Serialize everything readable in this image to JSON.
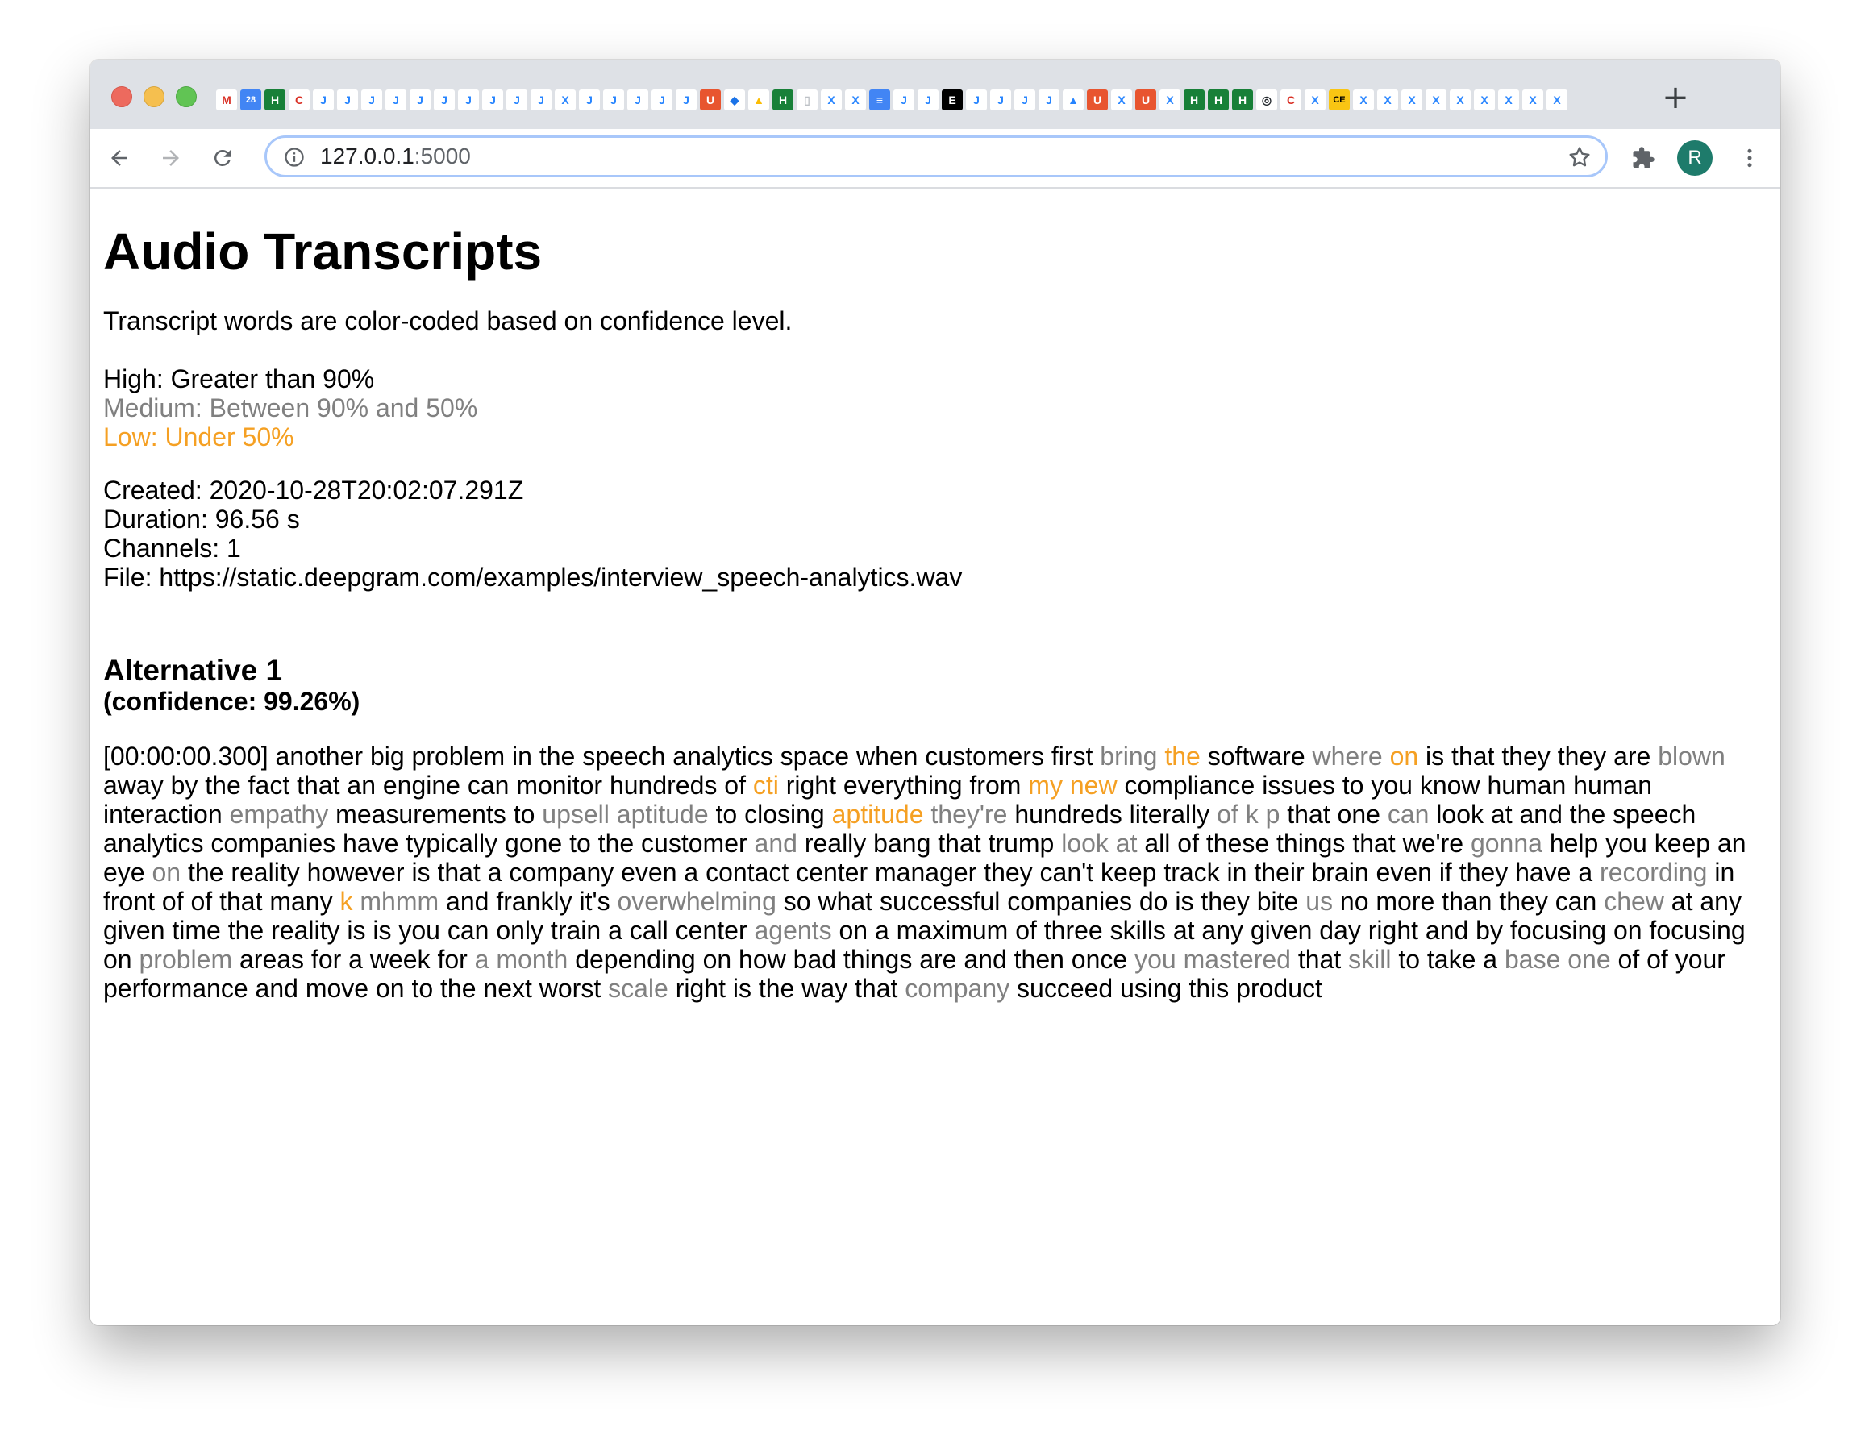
{
  "browser": {
    "url_host": "127.0.0.1",
    "url_port": ":5000",
    "avatar_letter": "R",
    "new_tab_symbol": "+",
    "tab_icons": [
      {
        "icon": "gmail-icon",
        "glyph": "M",
        "bg": "#ffffff",
        "fg": "#d93025"
      },
      {
        "icon": "calendar-icon",
        "glyph": "28",
        "bg": "#4285f4",
        "fg": "#ffffff"
      },
      {
        "icon": "sheets-icon",
        "glyph": "H",
        "bg": "#188038",
        "fg": "#ffffff"
      },
      {
        "icon": "refresh-red-icon",
        "glyph": "C",
        "bg": "#ffffff",
        "fg": "#d93025"
      },
      {
        "icon": "jira-icon",
        "glyph": "J",
        "bg": "#ffffff",
        "fg": "#2684ff"
      },
      {
        "icon": "jira-icon",
        "glyph": "J",
        "bg": "#ffffff",
        "fg": "#2684ff"
      },
      {
        "icon": "jira-icon",
        "glyph": "J",
        "bg": "#ffffff",
        "fg": "#2684ff"
      },
      {
        "icon": "jira-icon",
        "glyph": "J",
        "bg": "#ffffff",
        "fg": "#2684ff"
      },
      {
        "icon": "jira-icon",
        "glyph": "J",
        "bg": "#ffffff",
        "fg": "#2684ff"
      },
      {
        "icon": "jira-icon",
        "glyph": "J",
        "bg": "#ffffff",
        "fg": "#2684ff"
      },
      {
        "icon": "jira-icon",
        "glyph": "J",
        "bg": "#ffffff",
        "fg": "#2684ff"
      },
      {
        "icon": "jira-icon",
        "glyph": "J",
        "bg": "#ffffff",
        "fg": "#2684ff"
      },
      {
        "icon": "jira-icon",
        "glyph": "J",
        "bg": "#ffffff",
        "fg": "#2684ff"
      },
      {
        "icon": "jira-icon",
        "glyph": "J",
        "bg": "#ffffff",
        "fg": "#2684ff"
      },
      {
        "icon": "confluence-icon",
        "glyph": "X",
        "bg": "#ffffff",
        "fg": "#2684ff"
      },
      {
        "icon": "jira-icon",
        "glyph": "J",
        "bg": "#ffffff",
        "fg": "#2684ff"
      },
      {
        "icon": "jira-icon",
        "glyph": "J",
        "bg": "#ffffff",
        "fg": "#2684ff"
      },
      {
        "icon": "jira-icon",
        "glyph": "J",
        "bg": "#ffffff",
        "fg": "#2684ff"
      },
      {
        "icon": "jira-icon",
        "glyph": "J",
        "bg": "#ffffff",
        "fg": "#2684ff"
      },
      {
        "icon": "jira-icon",
        "glyph": "J",
        "bg": "#ffffff",
        "fg": "#2684ff"
      },
      {
        "icon": "shield-icon",
        "glyph": "U",
        "bg": "#e8552f",
        "fg": "#ffffff"
      },
      {
        "icon": "diamond-icon",
        "glyph": "◆",
        "bg": "#ffffff",
        "fg": "#1a73e8"
      },
      {
        "icon": "drive-icon",
        "glyph": "▲",
        "bg": "#ffffff",
        "fg": "#fbbc04"
      },
      {
        "icon": "sheets-icon",
        "glyph": "H",
        "bg": "#188038",
        "fg": "#ffffff"
      },
      {
        "icon": "blank-page-icon",
        "glyph": "▯",
        "bg": "#ffffff",
        "fg": "#bdc1c6"
      },
      {
        "icon": "confluence-icon",
        "glyph": "X",
        "bg": "#ffffff",
        "fg": "#2684ff"
      },
      {
        "icon": "confluence-icon",
        "glyph": "X",
        "bg": "#ffffff",
        "fg": "#2684ff"
      },
      {
        "icon": "docs-icon",
        "glyph": "≡",
        "bg": "#4285f4",
        "fg": "#ffffff"
      },
      {
        "icon": "jira-icon",
        "glyph": "J",
        "bg": "#ffffff",
        "fg": "#2684ff"
      },
      {
        "icon": "jira-icon",
        "glyph": "J",
        "bg": "#ffffff",
        "fg": "#2684ff"
      },
      {
        "icon": "black-e-icon",
        "glyph": "E",
        "bg": "#000000",
        "fg": "#ffffff"
      },
      {
        "icon": "jira-icon",
        "glyph": "J",
        "bg": "#ffffff",
        "fg": "#2684ff"
      },
      {
        "icon": "jira-icon",
        "glyph": "J",
        "bg": "#ffffff",
        "fg": "#2684ff"
      },
      {
        "icon": "jira-icon",
        "glyph": "J",
        "bg": "#ffffff",
        "fg": "#2684ff"
      },
      {
        "icon": "jira-icon",
        "glyph": "J",
        "bg": "#ffffff",
        "fg": "#2684ff"
      },
      {
        "icon": "atlassian-icon",
        "glyph": "▲",
        "bg": "#ffffff",
        "fg": "#2684ff"
      },
      {
        "icon": "shield-icon",
        "glyph": "U",
        "bg": "#e8552f",
        "fg": "#ffffff"
      },
      {
        "icon": "confluence-icon",
        "glyph": "X",
        "bg": "#ffffff",
        "fg": "#2684ff"
      },
      {
        "icon": "shield-icon",
        "glyph": "U",
        "bg": "#e8552f",
        "fg": "#ffffff"
      },
      {
        "icon": "confluence-icon",
        "glyph": "X",
        "bg": "#ffffff",
        "fg": "#2684ff"
      },
      {
        "icon": "sheets-icon",
        "glyph": "H",
        "bg": "#188038",
        "fg": "#ffffff"
      },
      {
        "icon": "sheets-icon",
        "glyph": "H",
        "bg": "#188038",
        "fg": "#ffffff"
      },
      {
        "icon": "sheets-icon",
        "glyph": "H",
        "bg": "#188038",
        "fg": "#ffffff"
      },
      {
        "icon": "github-icon",
        "glyph": "◎",
        "bg": "#ffffff",
        "fg": "#24292e"
      },
      {
        "icon": "refresh-red-icon",
        "glyph": "C",
        "bg": "#ffffff",
        "fg": "#d93025"
      },
      {
        "icon": "confluence-icon",
        "glyph": "X",
        "bg": "#ffffff",
        "fg": "#2684ff"
      },
      {
        "icon": "ce-icon",
        "glyph": "CE",
        "bg": "#f9c513",
        "fg": "#000000"
      },
      {
        "icon": "confluence-icon",
        "glyph": "X",
        "bg": "#ffffff",
        "fg": "#2684ff"
      },
      {
        "icon": "confluence-icon",
        "glyph": "X",
        "bg": "#ffffff",
        "fg": "#2684ff"
      },
      {
        "icon": "confluence-icon",
        "glyph": "X",
        "bg": "#ffffff",
        "fg": "#2684ff"
      },
      {
        "icon": "confluence-icon",
        "glyph": "X",
        "bg": "#ffffff",
        "fg": "#2684ff"
      },
      {
        "icon": "confluence-icon",
        "glyph": "X",
        "bg": "#ffffff",
        "fg": "#2684ff"
      },
      {
        "icon": "confluence-icon",
        "glyph": "X",
        "bg": "#ffffff",
        "fg": "#2684ff"
      },
      {
        "icon": "confluence-icon",
        "glyph": "X",
        "bg": "#ffffff",
        "fg": "#2684ff"
      },
      {
        "icon": "confluence-icon",
        "glyph": "X",
        "bg": "#ffffff",
        "fg": "#2684ff"
      },
      {
        "icon": "confluence-icon",
        "glyph": "X",
        "bg": "#ffffff",
        "fg": "#2684ff"
      }
    ]
  },
  "page": {
    "title": "Audio Transcripts",
    "legend_intro": "Transcript words are color-coded based on confidence level.",
    "legend": {
      "high": "High: Greater than 90%",
      "medium": "Medium: Between 90% and 50%",
      "low": "Low: Under 50%"
    },
    "meta": {
      "created": "Created: 2020-10-28T20:02:07.291Z",
      "duration": "Duration: 96.56 s",
      "channels": "Channels: 1",
      "file": "File: https://static.deepgram.com/examples/interview_speech-analytics.wav"
    },
    "alternative": {
      "heading": "Alternative 1",
      "confidence": "(confidence: 99.26%)"
    },
    "colors": {
      "high": "#000000",
      "medium": "#808080",
      "low": "#f5a023"
    },
    "transcript": {
      "timestamp": "[00:00:00.300]",
      "segments": [
        {
          "text": "another big problem in the speech analytics space when customers first",
          "level": "high"
        },
        {
          "text": "bring",
          "level": "medium"
        },
        {
          "text": "the",
          "level": "low"
        },
        {
          "text": "software",
          "level": "high"
        },
        {
          "text": "where",
          "level": "medium"
        },
        {
          "text": "on",
          "level": "low"
        },
        {
          "text": "is that they they are",
          "level": "high"
        },
        {
          "text": "blown",
          "level": "medium"
        },
        {
          "text": "away by the fact that an engine can monitor hundreds of",
          "level": "high"
        },
        {
          "text": "cti",
          "level": "low"
        },
        {
          "text": "right everything from",
          "level": "high"
        },
        {
          "text": "my new",
          "level": "low"
        },
        {
          "text": "compliance issues to you know human human interaction",
          "level": "high"
        },
        {
          "text": "empathy",
          "level": "medium"
        },
        {
          "text": "measurements to",
          "level": "high"
        },
        {
          "text": "upsell aptitude",
          "level": "medium"
        },
        {
          "text": "to closing",
          "level": "high"
        },
        {
          "text": "aptitude",
          "level": "low"
        },
        {
          "text": "they're",
          "level": "medium"
        },
        {
          "text": "hundreds literally",
          "level": "high"
        },
        {
          "text": "of k p",
          "level": "medium"
        },
        {
          "text": "that one",
          "level": "high"
        },
        {
          "text": "can",
          "level": "medium"
        },
        {
          "text": "look at and the speech analytics companies have typically gone to the customer",
          "level": "high"
        },
        {
          "text": "and",
          "level": "medium"
        },
        {
          "text": "really bang that trump",
          "level": "high"
        },
        {
          "text": "look at",
          "level": "medium"
        },
        {
          "text": "all of these things that we're",
          "level": "high"
        },
        {
          "text": "gonna",
          "level": "medium"
        },
        {
          "text": "help you keep an eye",
          "level": "high"
        },
        {
          "text": "on",
          "level": "medium"
        },
        {
          "text": "the reality however is that a company even a contact center manager they can't keep track in their brain even if they have a",
          "level": "high"
        },
        {
          "text": "recording",
          "level": "medium"
        },
        {
          "text": "in front of of that many",
          "level": "high"
        },
        {
          "text": "k",
          "level": "low"
        },
        {
          "text": "mhmm",
          "level": "medium"
        },
        {
          "text": "and frankly it's",
          "level": "high"
        },
        {
          "text": "overwhelming",
          "level": "medium"
        },
        {
          "text": "so what successful companies do is they bite",
          "level": "high"
        },
        {
          "text": "us",
          "level": "medium"
        },
        {
          "text": "no more than they can",
          "level": "high"
        },
        {
          "text": "chew",
          "level": "medium"
        },
        {
          "text": "at any given time the reality is is you can only train a call center",
          "level": "high"
        },
        {
          "text": "agents",
          "level": "medium"
        },
        {
          "text": "on a maximum of three skills at any given day right and by focusing on focusing on",
          "level": "high"
        },
        {
          "text": "problem",
          "level": "medium"
        },
        {
          "text": "areas for a week for",
          "level": "high"
        },
        {
          "text": "a month",
          "level": "medium"
        },
        {
          "text": "depending on how bad things are and then once",
          "level": "high"
        },
        {
          "text": "you mastered",
          "level": "medium"
        },
        {
          "text": "that",
          "level": "high"
        },
        {
          "text": "skill",
          "level": "medium"
        },
        {
          "text": "to take a",
          "level": "high"
        },
        {
          "text": "base one",
          "level": "medium"
        },
        {
          "text": "of of your performance and move on to the next worst",
          "level": "high"
        },
        {
          "text": "scale",
          "level": "medium"
        },
        {
          "text": "right is the way that",
          "level": "high"
        },
        {
          "text": "company",
          "level": "medium"
        },
        {
          "text": "succeed using this product",
          "level": "high"
        }
      ]
    }
  }
}
